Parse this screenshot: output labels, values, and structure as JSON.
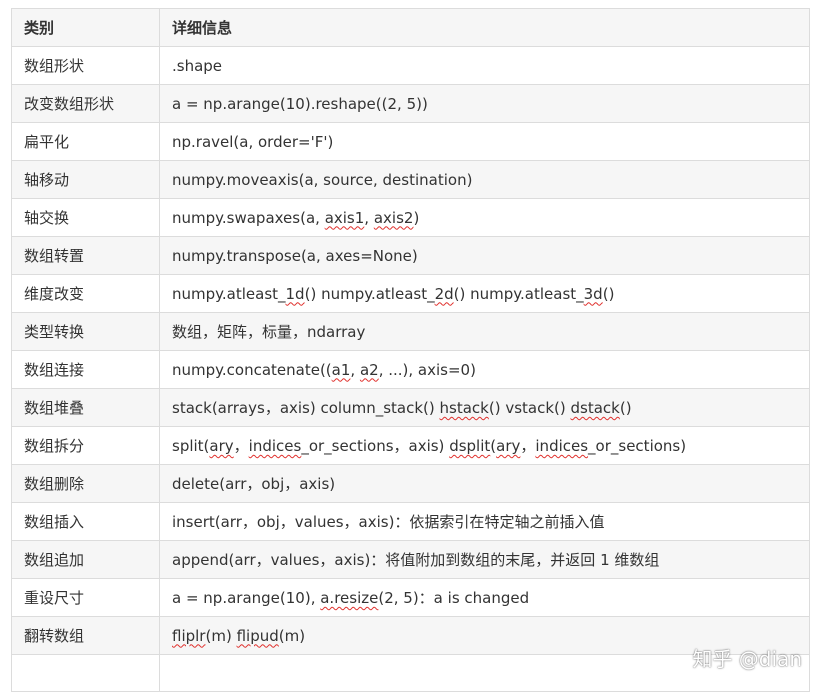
{
  "table": {
    "headers": [
      "类别",
      "详细信息"
    ],
    "rows": [
      {
        "category": "数组形状",
        "detail": [
          {
            "t": ".shape"
          }
        ]
      },
      {
        "category": "改变数组形状",
        "detail": [
          {
            "t": "a = np.arange(10).reshape((2, 5))"
          }
        ]
      },
      {
        "category": "扁平化",
        "detail": [
          {
            "t": "np.ravel(a, order='F')"
          }
        ]
      },
      {
        "category": "轴移动",
        "detail": [
          {
            "t": "numpy.moveaxis(a, source, destination)"
          }
        ]
      },
      {
        "category": "轴交换",
        "detail": [
          {
            "t": "numpy.swapaxes(a, "
          },
          {
            "t": "axis1",
            "u": true
          },
          {
            "t": ", "
          },
          {
            "t": "axis2",
            "u": true
          },
          {
            "t": ")"
          }
        ]
      },
      {
        "category": "数组转置",
        "detail": [
          {
            "t": "numpy.transpose(a, axes=None)"
          }
        ]
      },
      {
        "category": "维度改变",
        "detail": [
          {
            "t": "numpy.atleast_"
          },
          {
            "t": "1d",
            "u": true
          },
          {
            "t": "() numpy.atleast_"
          },
          {
            "t": "2d",
            "u": true
          },
          {
            "t": "() numpy.atleast_"
          },
          {
            "t": "3d",
            "u": true
          },
          {
            "t": "()"
          }
        ]
      },
      {
        "category": "类型转换",
        "detail": [
          {
            "t": "数组，矩阵，标量，ndarray"
          }
        ]
      },
      {
        "category": "数组连接",
        "detail": [
          {
            "t": "numpy.concatenate(("
          },
          {
            "t": "a1",
            "u": true
          },
          {
            "t": ", "
          },
          {
            "t": "a2",
            "u": true
          },
          {
            "t": ", ...), axis=0)"
          }
        ]
      },
      {
        "category": "数组堆叠",
        "detail": [
          {
            "t": "stack(arrays，axis)  column_stack() "
          },
          {
            "t": "hstack",
            "u": true
          },
          {
            "t": "() vstack() "
          },
          {
            "t": "dstack",
            "u": true
          },
          {
            "t": "()"
          }
        ]
      },
      {
        "category": "数组拆分",
        "detail": [
          {
            "t": "split("
          },
          {
            "t": "ary",
            "u": true
          },
          {
            "t": "，"
          },
          {
            "t": "indices",
            "u": true
          },
          {
            "t": "_or_sections，axis) "
          },
          {
            "t": "dsplit",
            "u": true
          },
          {
            "t": "("
          },
          {
            "t": "ary",
            "u": true
          },
          {
            "t": "，"
          },
          {
            "t": "indices",
            "u": true
          },
          {
            "t": "_or_sections)"
          }
        ]
      },
      {
        "category": "数组删除",
        "detail": [
          {
            "t": "delete(arr，obj，axis)"
          }
        ]
      },
      {
        "category": "数组插入",
        "detail": [
          {
            "t": "insert(arr，obj，values，axis)：依据索引在特定轴之前插入值"
          }
        ]
      },
      {
        "category": "数组追加",
        "detail": [
          {
            "t": "append(arr，values，axis)：将值附加到数组的末尾，并返回 1 维数组"
          }
        ]
      },
      {
        "category": "重设尺寸",
        "detail": [
          {
            "t": "a = np.arange(10), "
          },
          {
            "t": "a.resize",
            "u": true
          },
          {
            "t": "(2, 5)：a is changed"
          }
        ]
      },
      {
        "category": "翻转数组",
        "detail": [
          {
            "t": "fliplr",
            "u": true
          },
          {
            "t": "(m) "
          },
          {
            "t": "flipud",
            "u": true
          },
          {
            "t": "(m)"
          }
        ]
      },
      {
        "category": "",
        "detail": []
      }
    ]
  },
  "watermark": "知乎 @dian",
  "colors": {
    "text": "#333333",
    "border": "#dcdcdc",
    "stripe": "#f6f6f6",
    "spellcheck": "#e0302c"
  }
}
